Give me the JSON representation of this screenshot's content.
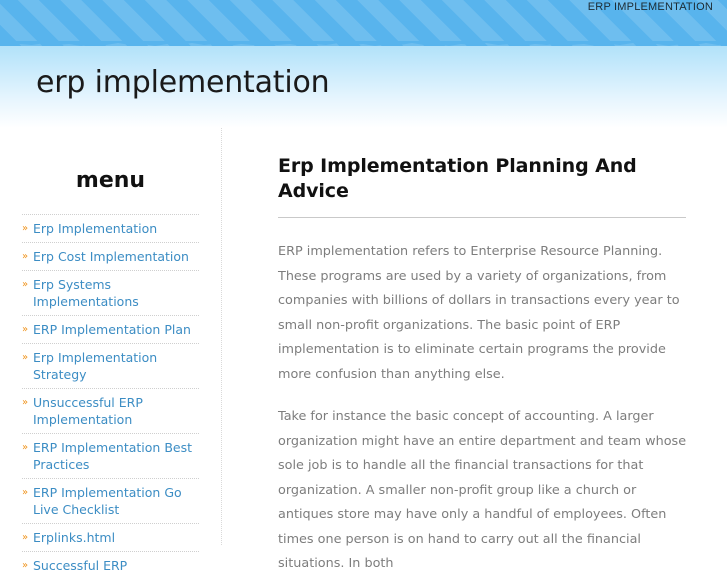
{
  "topbar": {
    "nav_label": "ERP IMPLEMENTATION",
    "stripe_color": "#58b4ed"
  },
  "masthead": {
    "site_title": "erp implementation",
    "gradient_top": "#b2e2fa",
    "gradient_bottom": "#ffffff"
  },
  "sidebar": {
    "heading": "menu",
    "bullet_glyph": "»",
    "bullet_color": "#f0941e",
    "link_color": "#3c8dc4",
    "items": [
      {
        "label": "Erp Implementation"
      },
      {
        "label": "Erp Cost Implementation"
      },
      {
        "label": "Erp Systems Implementations"
      },
      {
        "label": "ERP Implementation Plan"
      },
      {
        "label": "Erp Implementation Strategy"
      },
      {
        "label": "Unsuccessful ERP Implementation"
      },
      {
        "label": "ERP Implementation Best Practices"
      },
      {
        "label": "ERP Implementation Go Live Checklist"
      },
      {
        "label": "Erplinks.html"
      },
      {
        "label": "Successful ERP"
      }
    ]
  },
  "content": {
    "heading": "Erp Implementation Planning And Advice",
    "paragraphs": [
      "ERP implementation refers to Enterprise Resource Planning. These programs are used by a variety of organizations, from companies with billions of dollars in transactions every year to small non-profit organizations. The basic point of ERP implementation is to eliminate certain programs the provide more confusion than anything else.",
      "Take for instance the basic concept of accounting. A larger organization might have an entire department and team whose sole job is to handle all the financial transactions for that organization. A smaller non-profit group like a church or antiques store may have only a handful of employees. Often times one person is on hand to carry out all the financial situations. In both"
    ]
  }
}
